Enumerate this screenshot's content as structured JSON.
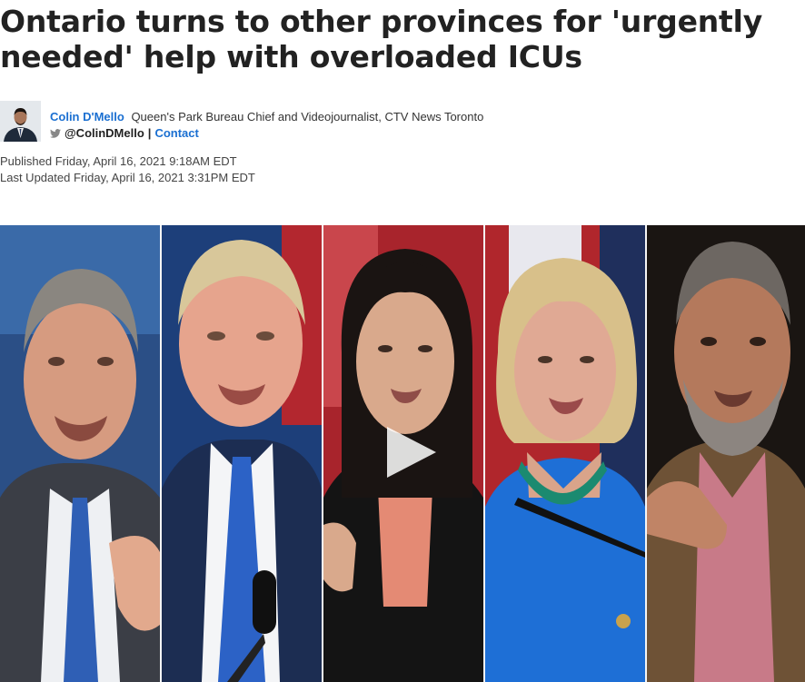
{
  "article": {
    "headline": "Ontario turns to other provinces for 'urgently needed' help with overloaded ICUs",
    "author": {
      "name": "Colin D'Mello",
      "title": "Queen's Park Bureau Chief and Videojournalist, CTV News Toronto",
      "twitter_handle": "@ColinDMello",
      "separator": "|",
      "contact_label": "Contact"
    },
    "published": "Published Friday, April 16, 2021 9:18AM EDT",
    "last_updated": "Last Updated Friday, April 16, 2021 3:31PM EDT"
  },
  "video": {
    "panels": [
      "panel-1",
      "panel-2",
      "panel-3",
      "panel-4",
      "panel-5"
    ],
    "play_icon": "play-icon"
  },
  "colors": {
    "link": "#1a6fd1",
    "headline": "#222222",
    "meta": "#444444"
  }
}
